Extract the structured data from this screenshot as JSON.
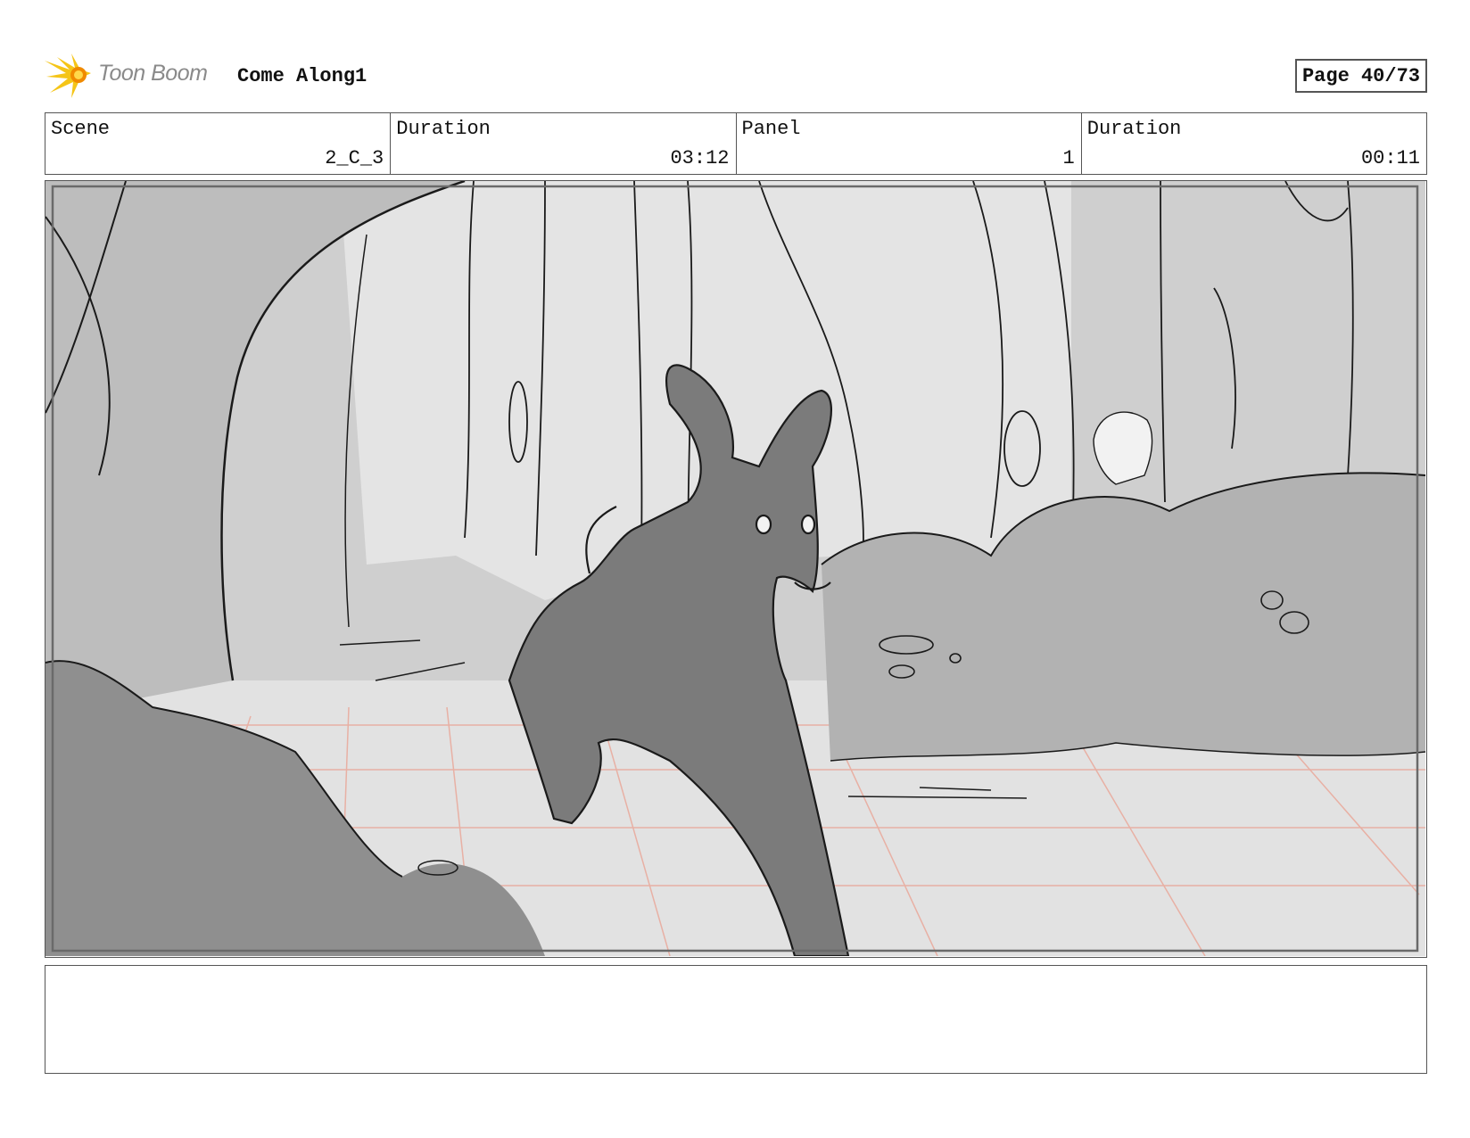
{
  "header": {
    "logo_text": "Toon Boom",
    "project_title": "Come Along1",
    "page_indicator": "Page 40/73"
  },
  "info": {
    "scene_label": "Scene",
    "scene_value": "2_C_3",
    "scene_duration_label": "Duration",
    "scene_duration_value": "03:12",
    "panel_label": "Panel",
    "panel_value": "1",
    "panel_duration_label": "Duration",
    "panel_duration_value": "00:11"
  },
  "colors": {
    "logo_yellow": "#f5c518",
    "logo_orange": "#f08a00",
    "sketch_line": "#1a1a1a",
    "perspective_grid": "#e8b0a4",
    "deer_fill": "#7b7b7b"
  },
  "icons": {
    "logo": "toon-boom-starburst-icon"
  }
}
